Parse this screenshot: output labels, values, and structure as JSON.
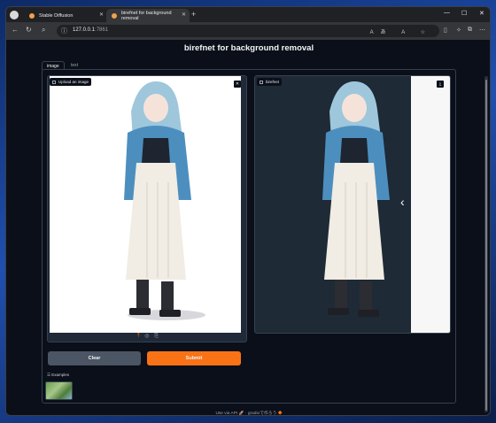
{
  "browser": {
    "tabs": [
      {
        "label": "Stable Diffusion"
      },
      {
        "label": "birefnet for background removal"
      }
    ],
    "url_host": "127.0.0.1",
    "url_port": ":7861",
    "new_tab": "+",
    "window_controls": [
      "—",
      "☐",
      "✕"
    ]
  },
  "page": {
    "title": "birefnet for background removal",
    "tabs": [
      "image",
      "text"
    ],
    "input_label": "Upload an image",
    "output_label": "birefnet",
    "clear_label": "Clear",
    "submit_label": "Submit",
    "examples_label": "Examples",
    "footer_api": "Use via API",
    "footer_sep": "·",
    "footer_built": "gradioで作ろう"
  },
  "colors": {
    "accent": "#f97316",
    "page_bg": "#0b0f19",
    "panel_bg": "#1f2937"
  }
}
